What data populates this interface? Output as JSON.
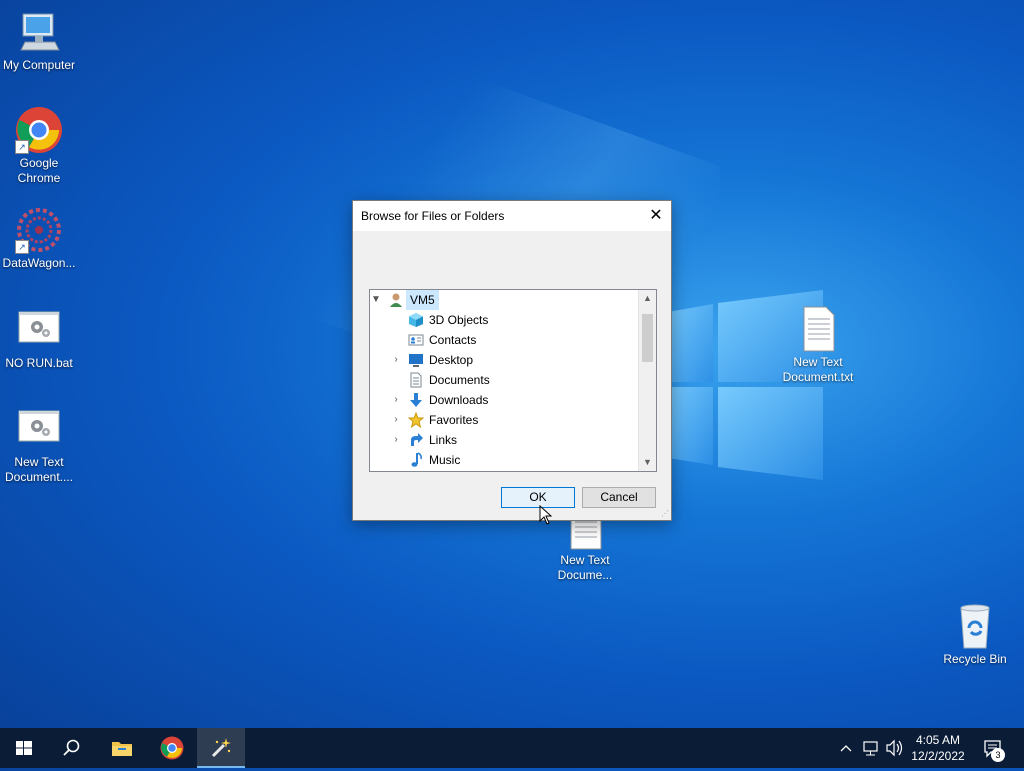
{
  "desktop": {
    "icons": [
      {
        "label": "My Computer",
        "icon": "computer-icon"
      },
      {
        "label": "Google Chrome",
        "icon": "chrome-icon"
      },
      {
        "label": "DataWagon...",
        "icon": "datawagon-icon"
      },
      {
        "label": "NO RUN.bat",
        "icon": "batch-file-icon"
      },
      {
        "label": "New Text Document....",
        "icon": "batch-file-icon"
      },
      {
        "label": "New Text Document.txt",
        "icon": "text-file-icon"
      },
      {
        "label": "New Text Docume...",
        "icon": "text-file-icon"
      },
      {
        "label": "Recycle Bin",
        "icon": "recycle-bin-icon"
      }
    ]
  },
  "dialog": {
    "title": "Browse for Files or Folders",
    "close_label": "✕",
    "tree": [
      {
        "label": "VM5",
        "icon": "user-icon",
        "expanded": true,
        "selected": true
      },
      {
        "label": "3D Objects",
        "icon": "3d-objects-icon"
      },
      {
        "label": "Contacts",
        "icon": "contacts-icon"
      },
      {
        "label": "Desktop",
        "icon": "desktop-icon",
        "expandable": true
      },
      {
        "label": "Documents",
        "icon": "documents-icon"
      },
      {
        "label": "Downloads",
        "icon": "downloads-icon",
        "expandable": true
      },
      {
        "label": "Favorites",
        "icon": "favorites-icon",
        "expandable": true
      },
      {
        "label": "Links",
        "icon": "links-icon",
        "expandable": true
      },
      {
        "label": "Music",
        "icon": "music-icon"
      }
    ],
    "ok_label": "OK",
    "cancel_label": "Cancel"
  },
  "taskbar": {
    "items": [
      {
        "name": "start",
        "icon": "windows-icon"
      },
      {
        "name": "search",
        "icon": "search-icon"
      },
      {
        "name": "file-explorer",
        "icon": "folder-icon"
      },
      {
        "name": "chrome",
        "icon": "chrome-icon"
      },
      {
        "name": "active-app",
        "icon": "magic-wand-icon",
        "active": true
      }
    ],
    "time": "4:05 AM",
    "date": "12/2/2022",
    "notification_count": "3"
  }
}
